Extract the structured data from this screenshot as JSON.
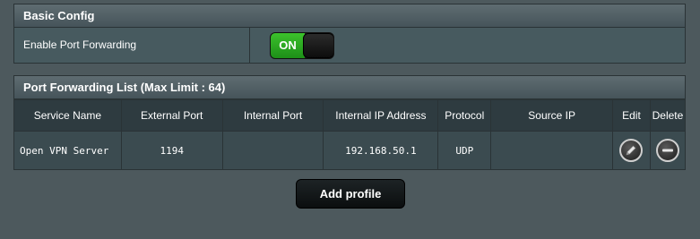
{
  "basic_config": {
    "title": "Basic Config",
    "enable_label": "Enable Port Forwarding",
    "toggle_state": "ON"
  },
  "port_forwarding": {
    "title": "Port Forwarding List (Max Limit : 64)",
    "columns": [
      "Service Name",
      "External Port",
      "Internal Port",
      "Internal IP Address",
      "Protocol",
      "Source IP",
      "Edit",
      "Delete"
    ],
    "rows": [
      {
        "service_name": "Open VPN Server",
        "external_port": "1194",
        "internal_port": "",
        "internal_ip": "192.168.50.1",
        "protocol": "UDP",
        "source_ip": "",
        "edit_icon": "pencil-icon",
        "delete_icon": "minus-icon"
      }
    ]
  },
  "add_profile_label": "Add profile",
  "colors": {
    "background": "#4d595d",
    "toggle_on": "#2aa421"
  }
}
